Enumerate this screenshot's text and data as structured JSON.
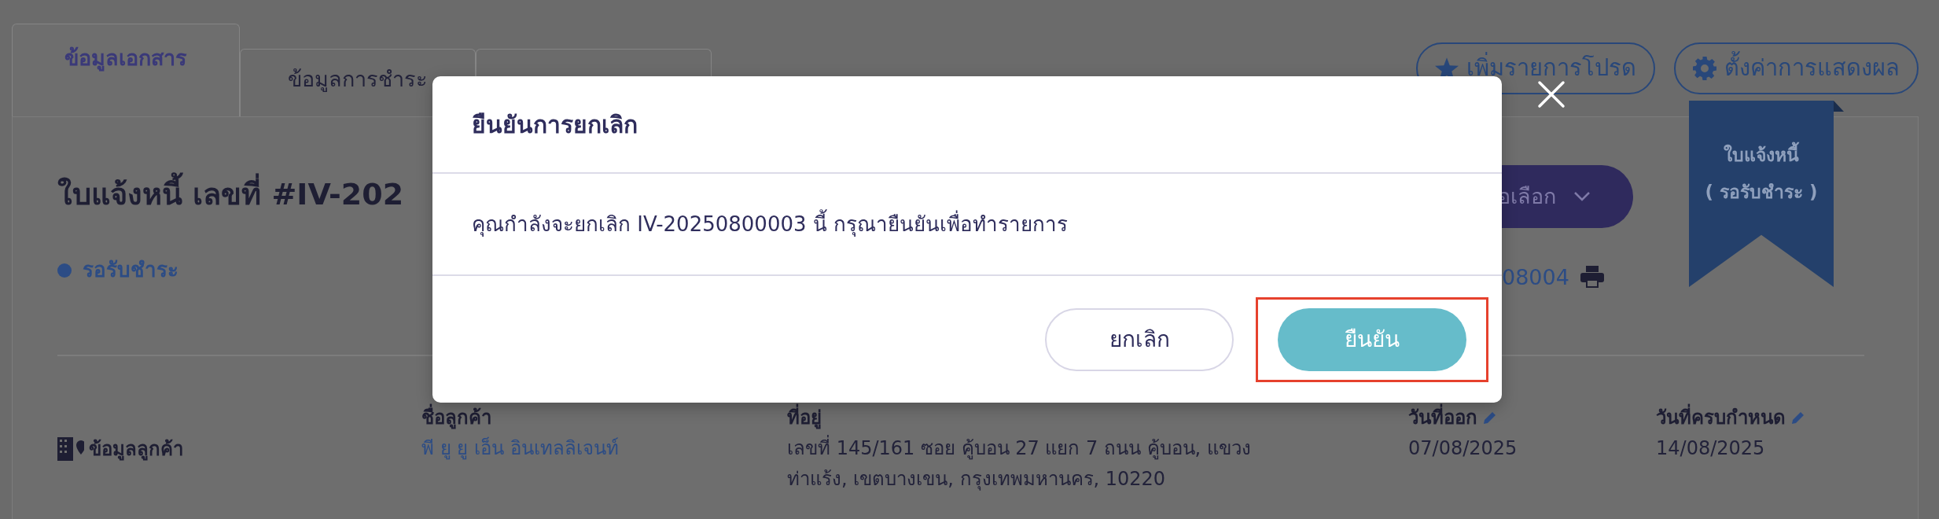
{
  "tabs": [
    {
      "label": "ข้อมูลเอกสาร",
      "selected": true
    },
    {
      "label": "ข้อมูลการชำระ",
      "selected": false
    },
    {
      "selected": false
    }
  ],
  "toolbar_buttons": [
    {
      "label": "เพิ่มรายการโปรด",
      "kind": "star"
    },
    {
      "label": "ตั้งค่าการแสดงผล",
      "kind": "gear"
    }
  ],
  "ribbon": {
    "title": "ใบแจ้งหนี้",
    "status": "( รอรับชำระ )"
  },
  "document": {
    "title": "ใบแจ้งหนี้ เลขที่ #IV-202",
    "status": "รอรับชำระ",
    "options_button": "อเลือก",
    "reference": "08004"
  },
  "customer": {
    "section": "ข้อมูลลูกค้า",
    "fields": [
      {
        "label": "ชื่อลูกค้า",
        "value": "พี ยู ยู เอ็น อินเทลลิเจนท์",
        "kind": "link",
        "editable": false
      },
      {
        "label": "ที่อยู่",
        "value": "เลขที่ 145/161 ซอย คู้บอน 27 แยก 7 ถนน คู้บอน, แขวงท่าแร้ง, เขตบางเขน, กรุงเทพมหานคร, 10220",
        "kind": "text",
        "editable": false
      },
      {
        "label": "วันที่ออก",
        "value": "07/08/2025",
        "kind": "text",
        "editable": true
      },
      {
        "label": "วันที่ครบกำหนด",
        "value": "14/08/2025",
        "kind": "text",
        "editable": true
      }
    ]
  },
  "modal": {
    "title": "ยืนยันการยกเลิก",
    "message": "คุณกำลังจะยกเลิก IV-20250800003 นี้ กรุณายืนยันเพื่อทำรายการ",
    "buttons": [
      {
        "label": "ยกเลิก",
        "kind": "secondary",
        "highlighted": false
      },
      {
        "label": "ยืนยัน",
        "kind": "primary",
        "highlighted": true
      }
    ]
  }
}
